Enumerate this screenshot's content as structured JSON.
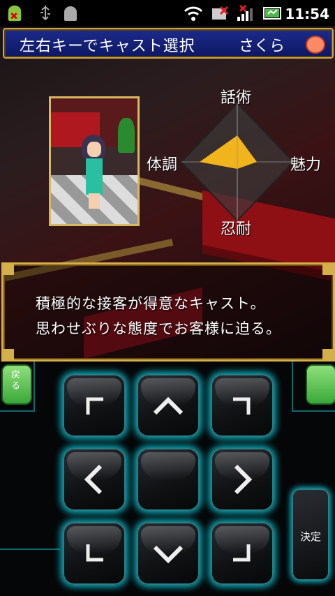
{
  "status_bar": {
    "time": "11:54",
    "icons": [
      "android-icon",
      "usb-icon",
      "android-debug-icon",
      "wifi-icon",
      "signal-off-icon",
      "signal-icon",
      "battery-icon"
    ]
  },
  "game": {
    "header": {
      "instruction": "左右キーでキャスト選択",
      "cast_name": "さくら",
      "face_icon": "smiley-face-icon"
    },
    "stats": {
      "top": "話術",
      "left": "体調",
      "right": "魅力",
      "bottom": "忍耐",
      "colors": {
        "fill": "#f2b41c",
        "frame": "#555555"
      }
    },
    "description": {
      "line1": "積極的な接客が得意なキャスト。",
      "line2": "思わせぶりな態度でお客様に迫る。"
    }
  },
  "controls": {
    "back_label": "戻る",
    "decide_label": "決定",
    "dpad": [
      "up-left",
      "up",
      "up-right",
      "left",
      "center",
      "right",
      "down-left",
      "down",
      "down-right"
    ],
    "accent_color": "#0ab6c4"
  }
}
